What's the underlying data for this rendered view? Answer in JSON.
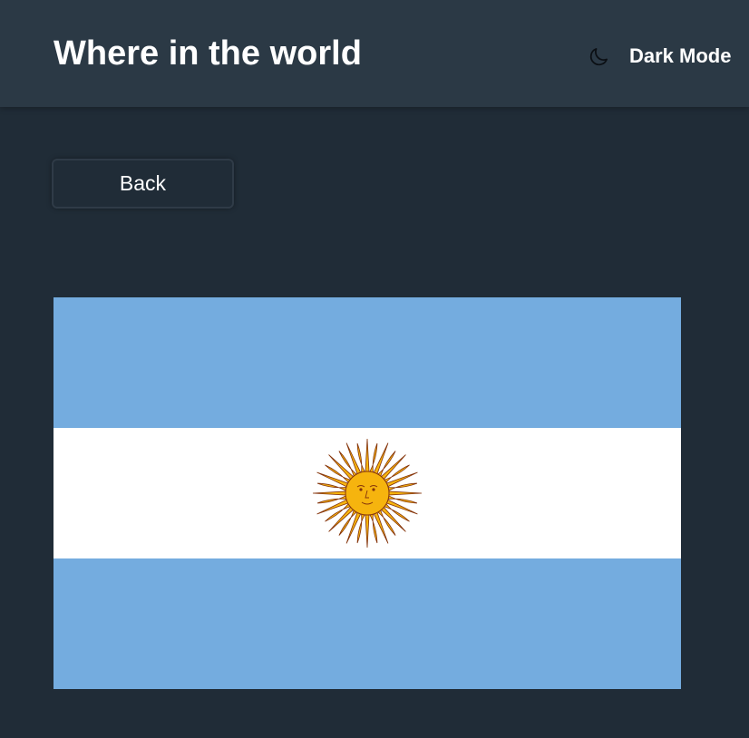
{
  "header": {
    "title": "Where in the world",
    "mode_toggle": {
      "icon": "moon-icon",
      "label": "Dark Mode"
    }
  },
  "detail": {
    "back_label": "Back",
    "flag": {
      "depicts": "Argentina",
      "colors": {
        "stripe_blue": "#74acdf",
        "stripe_white": "#ffffff",
        "sun": "#f6b40e",
        "sun_outline": "#85340a"
      }
    }
  },
  "theme": {
    "background": "#202c37",
    "surface": "#2b3945",
    "text": "#ffffff"
  }
}
